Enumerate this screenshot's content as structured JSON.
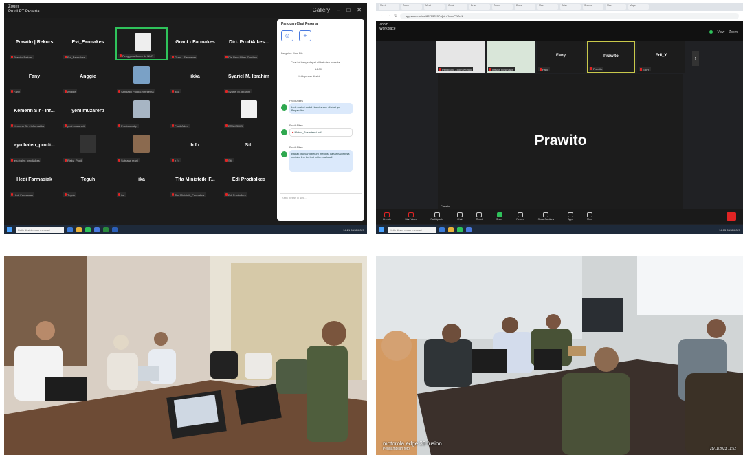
{
  "panel1": {
    "app_title": "Zoom",
    "app_subtitle": "Prodi PT Peserta",
    "window_controls": [
      "Gallery",
      "–",
      "□",
      "✕"
    ],
    "tiles": [
      {
        "name": "Prawito | Rekors",
        "tag": "Prawito Rekors"
      },
      {
        "name": "Evi_Farmakes",
        "tag": "Evi_Farmakes"
      },
      {
        "name": "",
        "tag": "Pengguna Zoom dr. NUR",
        "active": true,
        "img": "#eeeeee"
      },
      {
        "name": "Grant - Farmakes",
        "tag": "Grant - Farmakes"
      },
      {
        "name": "Diri. ProdiAlkes...",
        "tag": "Diri ProdiAlkes ZenMan"
      },
      {
        "name": "Fany",
        "tag": "Fany"
      },
      {
        "name": "Anggie",
        "tag": "Anggie"
      },
      {
        "name": "",
        "tag": "Sangatih Prodi/Zelmrirema",
        "img": "#7aa1c6"
      },
      {
        "name": "ikka",
        "tag": "ikka"
      },
      {
        "name": "Syariel M. Ibrahim",
        "tag": "Syariel M. Ibrahim"
      },
      {
        "name": "Kemenn Sir - Inf...",
        "tag": "Kemenn Sir - Informatika"
      },
      {
        "name": "yeni muzarerti",
        "tag": "yeni muzarerti"
      },
      {
        "name": "",
        "tag": "Produsenakp",
        "img": "#a7b5c4"
      },
      {
        "name": "",
        "tag": "Prodi Alkes",
        "img": "#1c1c1c"
      },
      {
        "name": "",
        "tag": "BRAMSHIS",
        "img": "#f2f2f2"
      },
      {
        "name": "ayu.balen_prodi...",
        "tag": "ayu.balen_prodialkes"
      },
      {
        "name": "",
        "tag": "Risky_Prodi",
        "img": "#333333"
      },
      {
        "name": "",
        "tag": "Sutriana reani",
        "img": "#8b6a4f"
      },
      {
        "name": "h f r",
        "tag": "h f r"
      },
      {
        "name": "Siti",
        "tag": "Siti"
      },
      {
        "name": "Hedi Farmasiak",
        "tag": "Hedi Farmasiak"
      },
      {
        "name": "Teguh",
        "tag": "Teguh"
      },
      {
        "name": "ika",
        "tag": "ika"
      },
      {
        "name": "Tita Ministeik_F...",
        "tag": "Tita Ministeik_Farmakes"
      },
      {
        "name": "Edi Prodialkes",
        "tag": "Edi Prodialkes"
      }
    ],
    "chat": {
      "title": "Panduan Chat Peserta",
      "btn_labels": [
        "Pengirim",
        "Kirim File"
      ],
      "sys_lines": [
        "Chat ini hanya dapat dilihat oleh peserta",
        "14.00",
        "Ketik pesan di sini"
      ],
      "messages": [
        {
          "sender": "Prodi Alkes",
          "text": "Link materi sudah kami share di chat ya Bapak/Ibu"
        },
        {
          "sender": "Prodi Alkes",
          "text": "Materi_Sosialisasi.pdf"
        },
        {
          "sender": "Prodi Alkes",
          "text": "Bapak Ibu yang belum mengisi daftar hadir bisa melalui link berikut ini terima kasih"
        }
      ],
      "input_placeholder": "Ketik pesan di sini..."
    },
    "taskbar": {
      "search": "Ketik di sini untuk mencari",
      "tray": "14:21 28/11/2023"
    }
  },
  "panel2": {
    "tabs": [
      "Meet",
      "Zoom",
      "Meet",
      "Gmail",
      "Drive",
      "Zoom",
      "Docs",
      "Meet",
      "Drive",
      "Sheets",
      "Meet",
      "Maps"
    ],
    "url": "app.zoom.us/wc/8871372374/join?fromPWA=1",
    "zoom_label": "Zoom",
    "zoom_sub": "Workplace",
    "top_right": [
      "View",
      "Zoom"
    ],
    "strip": [
      {
        "name": "",
        "tag": "Pengguna Zoom Workpl"
      },
      {
        "name": "",
        "tag": "Irawan Rosmawa"
      },
      {
        "name": "Fany",
        "tag": "Fany"
      },
      {
        "name": "Prawito",
        "tag": "Prawito",
        "active": true
      },
      {
        "name": "Edi_Y",
        "tag": "Edi Y"
      }
    ],
    "speaker": "Prawito",
    "speaker_tag": "Prawito",
    "controls": [
      "Unmute",
      "Start Video",
      "Participants",
      "Chat",
      "React",
      "Share",
      "Record",
      "Show Captions",
      "Apps",
      "More"
    ],
    "taskbar": {
      "search": "Ketik di sini untuk mencari",
      "tray": "14:15 28/11/2023"
    }
  },
  "photo2": {
    "brand": "motorola edge 30 fusion",
    "sub": "Pengambilan foto",
    "stamp": "28/11/2023 11:52"
  },
  "colors": {
    "accent_green": "#2fc25b",
    "mic_red": "#e02424",
    "zoom_blue": "#4a7adf"
  }
}
